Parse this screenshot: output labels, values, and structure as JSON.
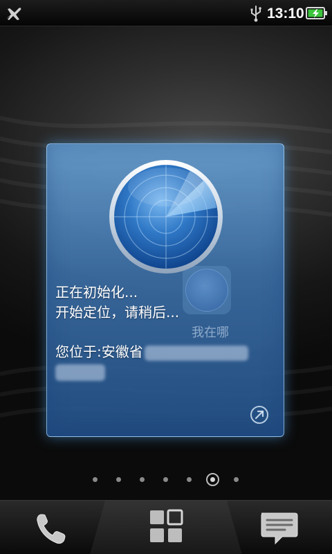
{
  "status_bar": {
    "time": "13:10",
    "icons": [
      "airplane-mode-icon",
      "usb-icon",
      "battery-charging-icon"
    ]
  },
  "widget": {
    "status_line_1": "正在初始化...",
    "status_line_2": "开始定位，请稍后...",
    "location_prefix": "您位于:安徽省",
    "background_app_label": "我在哪",
    "icons": [
      "radar-icon",
      "open-link-icon"
    ]
  },
  "page_indicator": {
    "total": 7,
    "current": 6
  },
  "dock": {
    "buttons": [
      "phone-icon",
      "all-apps-icon",
      "messages-icon"
    ]
  },
  "colors": {
    "widget_blue": "#3c6ea5",
    "battery_green": "#3cc43c",
    "radar_sweep": "#9fd0ff"
  }
}
